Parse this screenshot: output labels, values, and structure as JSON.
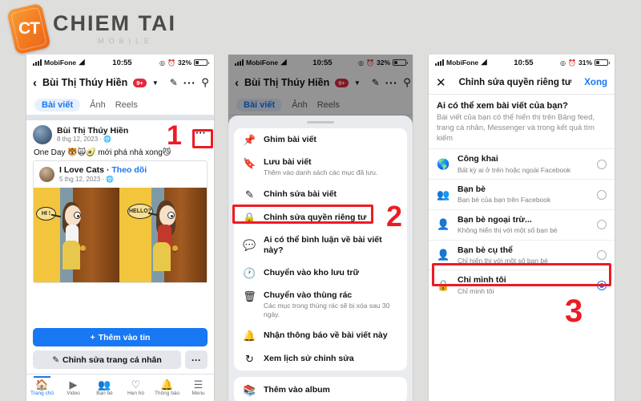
{
  "logo": {
    "mark": "CT",
    "name": "CHIEM TAI",
    "sub": "MOBILE"
  },
  "phone1": {
    "status": {
      "carrier": "MobiFone",
      "wifi_icon": "wifi-icon",
      "time": "10:55",
      "location_icon": "location-icon",
      "alarm_icon": "alarm-icon",
      "battery": "32%"
    },
    "header": {
      "back_icon": "back-chevron-icon",
      "title": "Bùi Thị Thúy Hiền",
      "badge": "9+",
      "caret_icon": "chevron-down-icon",
      "edit_icon": "pencil-icon",
      "more_icon": "ellipsis-icon",
      "search_icon": "search-icon"
    },
    "tabs": [
      {
        "label": "Bài viết",
        "active": true
      },
      {
        "label": "Ảnh",
        "active": false
      },
      {
        "label": "Reels",
        "active": false
      }
    ],
    "post": {
      "author": "Bùi Thị Thúy Hiền",
      "meta": "8 thg 12, 2023 · ",
      "globe_icon": "globe-icon",
      "text": "One Day 🐯🙀🥑 mới phá nhà xong😼",
      "more_icon": "ellipsis-icon"
    },
    "shared": {
      "page": "I Love Cats",
      "separator": "·",
      "follow": "Theo dõi",
      "meta": "5 thg 12, 2023 · ",
      "globe_icon": "globe-icon"
    },
    "comic": {
      "bubble_left": "HI !",
      "bubble_right": "HELLO?"
    },
    "actions": {
      "add_story": "Thêm vào tin",
      "add_story_icon": "plus-icon",
      "edit_profile": "Chỉnh sửa trang cá nhân",
      "edit_profile_icon": "pencil-icon",
      "more": "···"
    },
    "tabbar": [
      {
        "icon": "home-icon",
        "label": "Trang chủ",
        "active": true
      },
      {
        "icon": "video-icon",
        "label": "Video",
        "active": false
      },
      {
        "icon": "friends-icon",
        "label": "Bạn bè",
        "active": false
      },
      {
        "icon": "dating-icon",
        "label": "Hẹn hò",
        "active": false
      },
      {
        "icon": "bell-icon",
        "label": "Thông báo",
        "active": false
      },
      {
        "icon": "menu-icon",
        "label": "Menu",
        "active": false
      }
    ],
    "annotation": {
      "number": "1"
    }
  },
  "phone2": {
    "status": {
      "carrier": "MobiFone",
      "time": "10:55",
      "battery": "32%"
    },
    "header": {
      "title": "Bùi Thị Thúy Hiền",
      "badge": "9+"
    },
    "tabs": [
      {
        "label": "Bài viết",
        "active": true
      },
      {
        "label": "Ảnh",
        "active": false
      },
      {
        "label": "Reels",
        "active": false
      }
    ],
    "sheet_groups": [
      {
        "items": [
          {
            "icon": "pin-icon",
            "title": "Ghim bài viết",
            "subtitle": ""
          },
          {
            "icon": "bookmark-icon",
            "title": "Lưu bài viết",
            "subtitle": "Thêm vào danh sách các mục đã lưu."
          },
          {
            "icon": "pencil-icon",
            "title": "Chỉnh sửa bài viết",
            "subtitle": ""
          },
          {
            "icon": "lock-icon",
            "title": "Chỉnh sửa quyền riêng tư",
            "subtitle": "",
            "highlighted": true
          },
          {
            "icon": "comment-icon",
            "title": "Ai có thể bình luận về bài viết này?",
            "subtitle": ""
          },
          {
            "icon": "archive-clock-icon",
            "title": "Chuyển vào kho lưu trữ",
            "subtitle": ""
          },
          {
            "icon": "trash-icon",
            "title": "Chuyển vào thùng rác",
            "subtitle": "Các mục trong thùng rác sẽ bị xóa sau 30 ngày."
          },
          {
            "icon": "bell-icon",
            "title": "Nhận thông báo về bài viết này",
            "subtitle": ""
          },
          {
            "icon": "history-icon",
            "title": "Xem lịch sử chỉnh sửa",
            "subtitle": ""
          }
        ]
      },
      {
        "items": [
          {
            "icon": "stack-icon",
            "title": "Thêm vào album",
            "subtitle": ""
          }
        ]
      }
    ],
    "annotation": {
      "number": "2"
    }
  },
  "phone3": {
    "status": {
      "carrier": "MobiFone",
      "time": "10:55",
      "battery": "31%"
    },
    "header": {
      "close_icon": "close-icon",
      "title": "Chỉnh sửa quyền riêng tư",
      "done": "Xong"
    },
    "question": "Ai có thể xem bài viết của bạn?",
    "description": "Bài viết của bạn có thể hiển thị trên Bảng feed, trang cá nhân, Messenger và trong kết quả tìm kiếm",
    "options": [
      {
        "icon": "globe-icon",
        "title": "Công khai",
        "subtitle": "Bất kỳ ai ở trên hoặc ngoài Facebook",
        "selected": false
      },
      {
        "icon": "friends-icon",
        "title": "Bạn bè",
        "subtitle": "Bạn bè của bạn trên Facebook",
        "selected": false
      },
      {
        "icon": "friends-except-icon",
        "title": "Bạn bè ngoại trừ...",
        "subtitle": "Không hiển thị với một số bạn bè",
        "selected": false
      },
      {
        "icon": "person-icon",
        "title": "Bạn bè cụ thể",
        "subtitle": "Chỉ hiển thị với một số bạn bè",
        "selected": false
      },
      {
        "icon": "lock-icon",
        "title": "Chỉ mình tôi",
        "subtitle": "Chỉ mình tôi",
        "selected": true,
        "highlighted": true
      }
    ],
    "annotation": {
      "number": "3"
    }
  },
  "colors": {
    "accent": "#1877f2",
    "annotation": "#ee1b24",
    "badge": "#e02a3c",
    "page_bg": "#dededc"
  }
}
